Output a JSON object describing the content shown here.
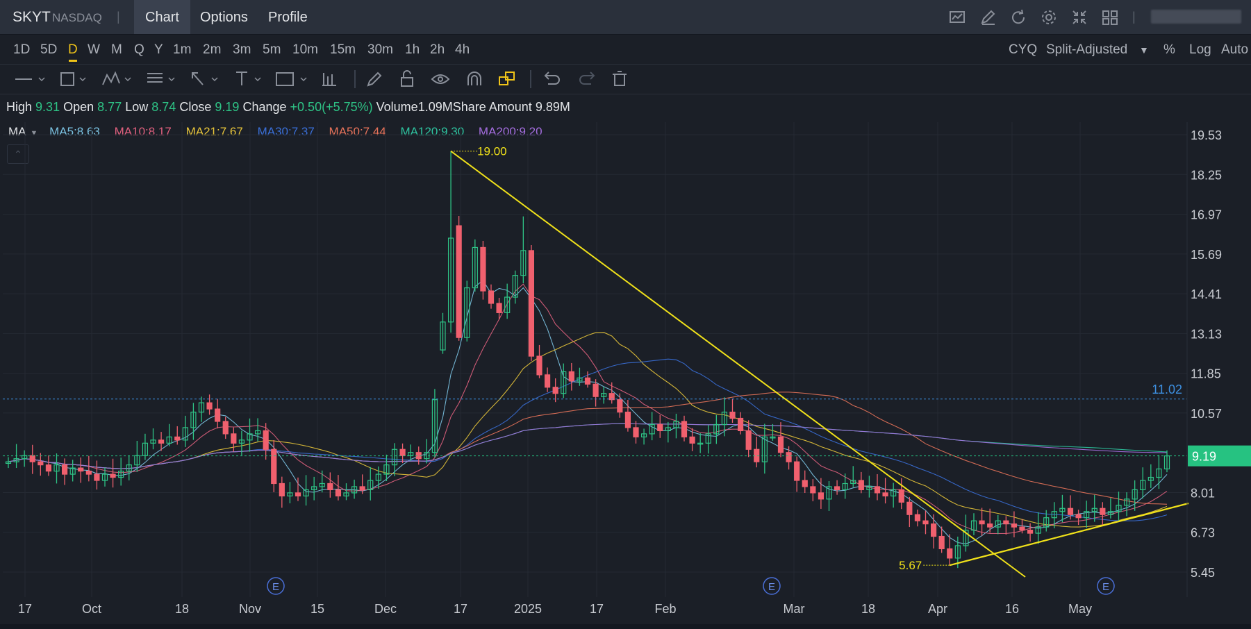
{
  "header": {
    "symbol": "SKYT",
    "exchange": "NASDAQ",
    "separator": "|",
    "tabs": [
      "Chart",
      "Options",
      "Profile"
    ],
    "active_tab": "Chart",
    "tools": [
      "chart-settings-icon",
      "draw-icon",
      "refresh-icon",
      "gear-icon",
      "collapse-icon",
      "grid-layout-icon"
    ]
  },
  "timeframes": [
    "1D",
    "5D",
    "D",
    "W",
    "M",
    "Q",
    "Y",
    "1m",
    "2m",
    "3m",
    "5m",
    "10m",
    "15m",
    "30m",
    "1h",
    "2h",
    "4h"
  ],
  "selected_timeframe": "D",
  "chart_options": {
    "cyq": "CYQ",
    "adjust": "Split-Adjusted",
    "percent": "%",
    "log": "Log",
    "auto": "Auto"
  },
  "quote": {
    "high_label": "High",
    "high": "9.31",
    "open_label": "Open",
    "open": "8.77",
    "low_label": "Low",
    "low": "8.74",
    "close_label": "Close",
    "close": "9.19",
    "change_label": "Change",
    "change": "+0.50(+5.75%)",
    "volume_label": "Volume",
    "volume": "1.09M",
    "share_label": "Share Amount",
    "share_amount": "9.89M"
  },
  "ma_label": "MA",
  "ma_lines": [
    {
      "text": "MA5:8.63",
      "color": "#7cc4e4"
    },
    {
      "text": "MA10:8.17",
      "color": "#e0607e"
    },
    {
      "text": "MA21:7.67",
      "color": "#e8c53a"
    },
    {
      "text": "MA30:7.37",
      "color": "#3a6fd8"
    },
    {
      "text": "MA50:7.44",
      "color": "#e8735a"
    },
    {
      "text": "MA120:9.30",
      "color": "#2ec4a0"
    },
    {
      "text": "MA200:9.20",
      "color": "#a56ee0"
    }
  ],
  "colors": {
    "up": "#2ec486",
    "down": "#f0606e",
    "annotation": "#f0e11a",
    "price_tag": "#26c281",
    "hline": "#3d8fe0"
  },
  "chart_data": {
    "type": "candlestick",
    "yticks": [
      "19.53",
      "18.25",
      "16.97",
      "15.69",
      "14.41",
      "13.13",
      "11.85",
      "10.57",
      "9.19",
      "8.01",
      "6.73",
      "5.45"
    ],
    "ylim": [
      5.45,
      19.53
    ],
    "xticks": [
      "17",
      "Oct",
      "18",
      "Nov",
      "15",
      "Dec",
      "17",
      "2025",
      "17",
      "Feb",
      "Mar",
      "18",
      "Apr",
      "16",
      "May"
    ],
    "last_price": "9.19",
    "horizontal_line": "11.02",
    "max_annotation": "19.00",
    "min_annotation": "5.67",
    "earnings_marker": "E",
    "close_path": [
      9.0,
      9.1,
      9.2,
      9.0,
      8.9,
      8.7,
      8.9,
      8.6,
      8.8,
      8.7,
      8.6,
      8.4,
      8.6,
      8.5,
      8.7,
      8.9,
      9.2,
      9.6,
      9.7,
      9.6,
      9.8,
      9.7,
      10.1,
      10.6,
      10.9,
      10.7,
      10.3,
      9.9,
      9.6,
      9.7,
      9.9,
      10.0,
      9.4,
      8.3,
      7.9,
      8.0,
      7.9,
      8.1,
      8.2,
      8.3,
      8.1,
      7.9,
      8.0,
      8.2,
      8.1,
      8.4,
      8.6,
      8.9,
      9.4,
      9.2,
      9.3,
      9.1,
      9.3,
      11.0,
      13.5,
      16.2,
      13.0,
      14.6,
      15.9,
      14.5,
      14.1,
      13.8,
      14.3,
      15.0,
      15.8,
      12.4,
      11.8,
      11.4,
      11.2,
      11.9,
      11.6,
      11.7,
      11.5,
      11.1,
      11.2,
      11.0,
      10.6,
      10.1,
      9.8,
      9.9,
      10.2,
      10.0,
      10.1,
      10.3,
      9.8,
      9.6,
      9.6,
      9.9,
      10.2,
      10.6,
      10.4,
      10.0,
      9.4,
      9.0,
      9.8,
      9.8,
      9.3,
      9.0,
      8.4,
      8.2,
      8.0,
      7.8,
      8.2,
      8.1,
      8.3,
      8.4,
      8.1,
      8.2,
      8.0,
      7.9,
      8.1,
      7.7,
      7.3,
      7.1,
      7.0,
      6.6,
      6.2,
      5.9,
      6.3,
      6.8,
      7.1,
      7.0,
      6.9,
      7.1,
      7.0,
      6.9,
      6.8,
      6.7,
      6.9,
      7.2,
      7.4,
      7.5,
      7.3,
      7.2,
      7.4,
      7.5,
      7.3,
      7.4,
      7.6,
      7.8,
      8.1,
      8.4,
      8.5,
      8.77,
      9.19
    ]
  }
}
